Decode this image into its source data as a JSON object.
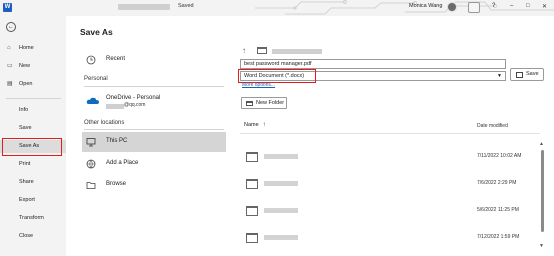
{
  "titlebar": {
    "app_letter": "W",
    "saved": "Saved",
    "user_name": "Monica Wang",
    "help": "?"
  },
  "sidebar": {
    "back_icon": "←",
    "items": [
      {
        "label": "Home",
        "icon": "⌂"
      },
      {
        "label": "New",
        "icon": "▭"
      },
      {
        "label": "Open",
        "icon": "▤"
      },
      {
        "label": "Info",
        "icon": ""
      },
      {
        "label": "Save",
        "icon": ""
      },
      {
        "label": "Save As",
        "icon": ""
      },
      {
        "label": "Print",
        "icon": ""
      },
      {
        "label": "Share",
        "icon": ""
      },
      {
        "label": "Export",
        "icon": ""
      },
      {
        "label": "Transform",
        "icon": ""
      },
      {
        "label": "Close",
        "icon": ""
      }
    ],
    "active_item": "Save As"
  },
  "main": {
    "title": "Save As",
    "recent_label": "Recent",
    "personal_label": "Personal",
    "onedrive_label": "OneDrive - Personal",
    "onedrive_email_suffix": "@qq.com",
    "other_locations_label": "Other locations",
    "this_pc_label": "This PC",
    "add_place_label": "Add a Place",
    "browse_label": "Browse"
  },
  "save_pane": {
    "filename": "best password manager.pdf",
    "filetype": "Word Document (*.docx)",
    "more_options": "More options...",
    "save_button": "Save",
    "new_folder_button": "New Folder",
    "col_name": "Name",
    "col_date": "Date modified",
    "files": [
      {
        "date": "7/11/2022 10:02 AM"
      },
      {
        "date": "7/6/2022 2:29 PM"
      },
      {
        "date": "5/6/2022 11:25 PM"
      },
      {
        "date": "7/12/2022 1:59 PM"
      }
    ]
  },
  "colors": {
    "highlight": "#e11e1e",
    "link": "#1a5fb4",
    "word_blue": "#1b5ebe",
    "onedrive_blue": "#0f6cbd"
  }
}
